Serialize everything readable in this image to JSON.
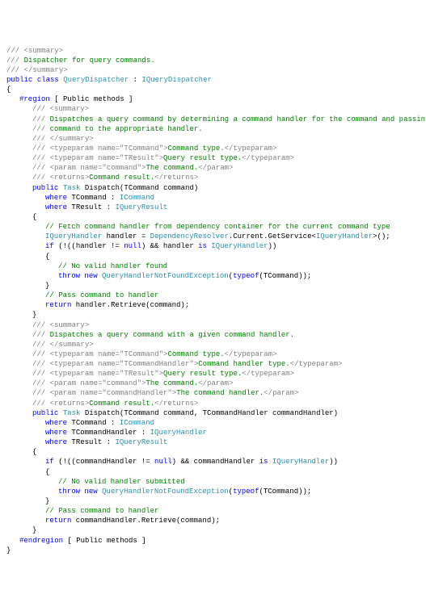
{
  "xml": {
    "summaryOpen": "<summary>",
    "summaryClose": "</summary>",
    "returnsOpen": "<returns>",
    "returnsClose": "</returns>",
    "paramClose": "</param>",
    "typeparamClose": "</typeparam>",
    "tpCommandOpen": "<typeparam name=\"TCommand\">",
    "tpResultOpen": "<typeparam name=\"TResult\">",
    "tpHandlerOpen": "<typeparam name=\"TCommandHandler\">",
    "pCommandOpen": "<param name=\"command\">",
    "pHandlerOpen": "<param name=\"commandHandler\">"
  },
  "txt": {
    "classSummary": "Dispatcher for query commands.",
    "m1Summary1": "Dispatches a query command by determining a command handler for the command and passing the",
    "m1Summary2": "command to the appropriate handler.",
    "tpCommand": "Command type.",
    "tpResult": "Query result type.",
    "tpHandler": "Command handler type.",
    "pCommand": "The command.",
    "pHandler": "The command handler.",
    "returns": "Command result.",
    "m2Summary": "Dispatches a query command with a given command handler.",
    "cFetch": "// Fetch command handler from dependency container for the current command type",
    "cNoHandler": "// No valid handler found",
    "cNoHandlerSub": "// No valid handler submitted",
    "cPass": "// Pass command to handler",
    "slashes": "/// "
  },
  "kw": {
    "public": "public",
    "class": "class",
    "where": "where",
    "if": "if",
    "null": "null",
    "is": "is",
    "throw": "throw",
    "new": "new",
    "typeof": "typeof",
    "return": "return"
  },
  "id": {
    "QueryDispatcher": "QueryDispatcher",
    "IQueryDispatcher": "IQueryDispatcher",
    "Task": "Task",
    "Dispatch": "Dispatch",
    "TCommand": "TCommand",
    "TResult": "TResult",
    "TCommandHandler": "TCommandHandler",
    "ICommand": "ICommand",
    "IQueryResult": "IQueryResult",
    "IQueryHandler": "IQueryHandler",
    "DependencyResolver": "DependencyResolver",
    "QueryHandlerNotFoundException": "QueryHandlerNotFoundException",
    "command": "command",
    "commandHandler": "commandHandler",
    "handler": "handler",
    "Current": ".Current.GetService<",
    "Retrieve": ".Retrieve("
  },
  "region": {
    "start": "#region",
    "end": "#endregion",
    "label": " [ Public methods ]"
  }
}
